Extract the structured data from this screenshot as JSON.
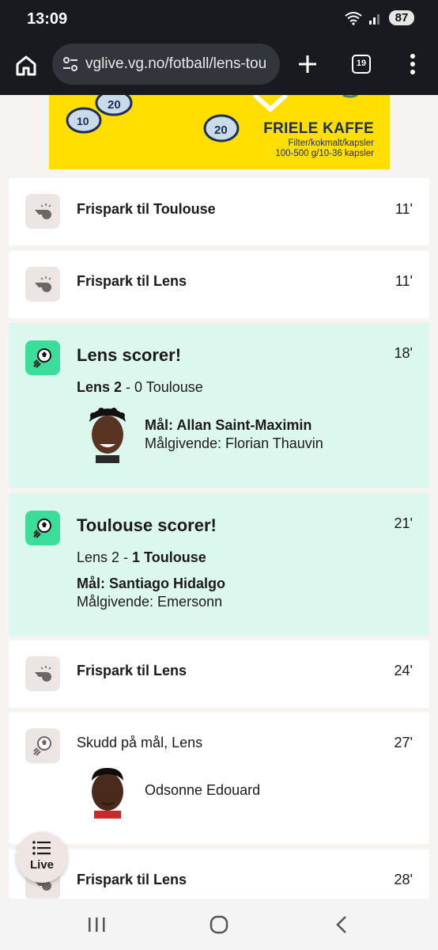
{
  "status": {
    "time": "13:09",
    "battery": "87"
  },
  "browser": {
    "url": "vglive.vg.no/fotball/lens-tou",
    "tab_count": "19"
  },
  "ad": {
    "brand": "FRIELE KAFFE",
    "line1": "Filter/kokmalt/kapsler",
    "line2": "100-500 g/10-36 kapsler"
  },
  "events": [
    {
      "type": "free-kick",
      "title": "Frispark til Toulouse",
      "minute": "11'"
    },
    {
      "type": "free-kick",
      "title": "Frispark til Lens",
      "minute": "11'"
    },
    {
      "type": "goal",
      "title": "Lens scorer!",
      "minute": "18'",
      "score_home": "Lens 2",
      "score_sep": " - ",
      "score_away": "0 Toulouse",
      "goal_label": "Mål: Allan Saint-Maximin",
      "assist_label": "Målgivende: Florian Thauvin"
    },
    {
      "type": "goal",
      "title": "Toulouse scorer!",
      "minute": "21'",
      "score_home": "Lens 2",
      "score_sep": " - ",
      "score_away": "1 Toulouse",
      "goal_label": "Mål: Santiago Hidalgo",
      "assist_label": "Målgivende: Emersonn"
    },
    {
      "type": "free-kick",
      "title": "Frispark til Lens",
      "minute": "24'"
    },
    {
      "type": "shot",
      "title": "Skudd på mål, Lens",
      "minute": "27'",
      "player": "Odsonne Edouard"
    },
    {
      "type": "free-kick",
      "title": "Frispark til Lens",
      "minute": "28'"
    }
  ],
  "live_button": {
    "label": "Live"
  },
  "icons": {
    "whistle": "whistle-icon",
    "goal": "goal-ball-icon",
    "shot": "shot-on-target-icon"
  },
  "colors": {
    "goal_bg": "#dcf8ee",
    "goal_icon": "#3cdc9a",
    "ad_bg": "#ffde00"
  }
}
